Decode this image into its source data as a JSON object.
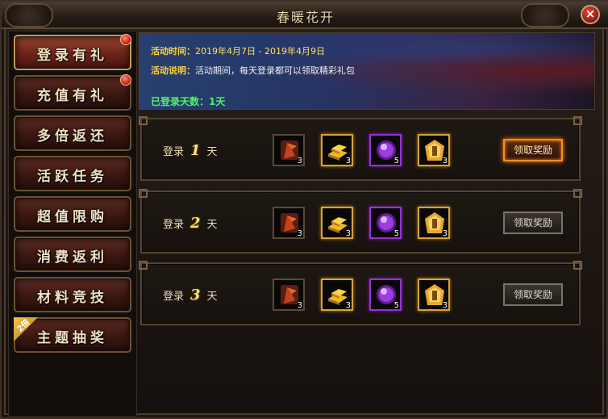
{
  "window": {
    "title": "春暖花开",
    "close_label": "×"
  },
  "sidebar": {
    "items": [
      {
        "label": "登录有礼",
        "active": true,
        "dot": true
      },
      {
        "label": "充值有礼",
        "active": false,
        "dot": true
      },
      {
        "label": "多倍返还",
        "active": false,
        "dot": false
      },
      {
        "label": "活跃任务",
        "active": false,
        "dot": false
      },
      {
        "label": "超值限购",
        "active": false,
        "dot": false
      },
      {
        "label": "消费返利",
        "active": false,
        "dot": false
      },
      {
        "label": "材料竞技",
        "active": false,
        "dot": false
      },
      {
        "label": "主题抽奖",
        "active": false,
        "dot": false,
        "badge": "2倍"
      }
    ]
  },
  "banner": {
    "time_key": "活动时间：",
    "date_start": "2019年4月7日",
    "date_sep": " - ",
    "date_end": "2019年4月9日",
    "desc_key": "活动说明：",
    "desc_val": "活动期间，每天登录都可以领取精彩礼包",
    "days_key": "已登录天数：",
    "days_val": "1天"
  },
  "rows": [
    {
      "prefix": "登录",
      "day": "1",
      "suffix": "天",
      "items": [
        {
          "icon": "red-flag-icon",
          "count": "3"
        },
        {
          "icon": "gold-bars-icon",
          "count": "3"
        },
        {
          "icon": "purple-orb-icon",
          "count": "5"
        },
        {
          "icon": "gold-token-icon",
          "count": "3"
        }
      ],
      "button": "领取奖励",
      "button_hot": true
    },
    {
      "prefix": "登录",
      "day": "2",
      "suffix": "天",
      "items": [
        {
          "icon": "red-flag-icon",
          "count": "3"
        },
        {
          "icon": "gold-bars-icon",
          "count": "3"
        },
        {
          "icon": "purple-orb-icon",
          "count": "5"
        },
        {
          "icon": "gold-token-icon",
          "count": "3"
        }
      ],
      "button": "领取奖励",
      "button_hot": false
    },
    {
      "prefix": "登录",
      "day": "3",
      "suffix": "天",
      "items": [
        {
          "icon": "red-flag-icon",
          "count": "3"
        },
        {
          "icon": "gold-bars-icon",
          "count": "3"
        },
        {
          "icon": "purple-orb-icon",
          "count": "5"
        },
        {
          "icon": "gold-token-icon",
          "count": "3"
        }
      ],
      "button": "领取奖励",
      "button_hot": false
    }
  ]
}
